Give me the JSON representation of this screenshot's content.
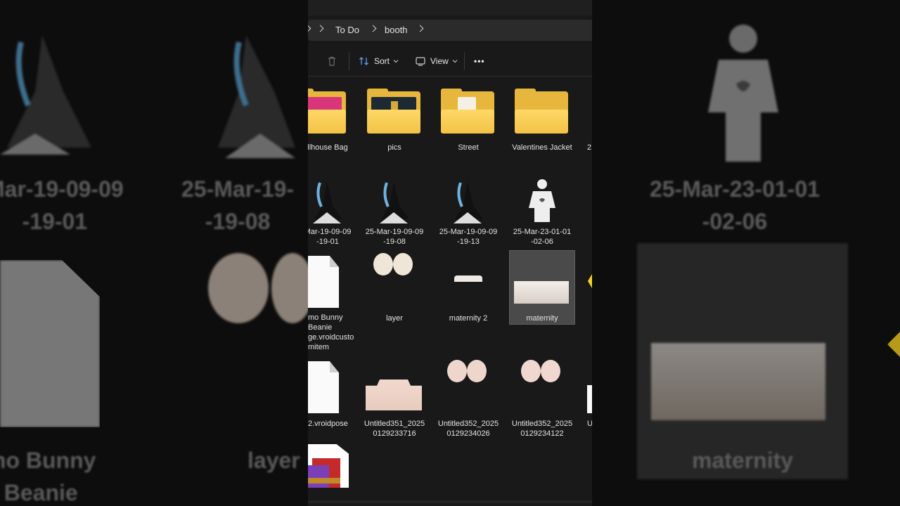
{
  "background_left": {
    "text_1": "Mar-19-09-09\n-19-01",
    "text_2": "25-Mar-19-\n-19-08",
    "text_3": "mo Bunny\nBeanie",
    "text_4": "layer"
  },
  "background_right": {
    "text_1": "25-Mar-23-01-01\n-02-06",
    "text_2": "maternity"
  },
  "explorer": {
    "breadcrumb": [
      "To Do",
      "booth"
    ],
    "toolbar": {
      "sort_label": "Sort",
      "view_label": "View",
      "more_label": "•••"
    },
    "items": [
      {
        "label": "llhouse Bag",
        "type": "folder"
      },
      {
        "label": "pics",
        "type": "folder"
      },
      {
        "label": "Street",
        "type": "folder"
      },
      {
        "label": "Valentines Jacket",
        "type": "folder"
      },
      {
        "label": "2",
        "type": "folder"
      },
      {
        "label": "Mar-19-09-09\n-19-01",
        "type": "image"
      },
      {
        "label": "25-Mar-19-09-09\n-19-08",
        "type": "image"
      },
      {
        "label": "25-Mar-19-09-09\n-19-13",
        "type": "image"
      },
      {
        "label": "25-Mar-23-01-01\n-02-06",
        "type": "image"
      },
      {
        "label": "mo Bunny\nBeanie\nge.vroidcusto\nmitem",
        "type": "file"
      },
      {
        "label": "layer",
        "type": "image"
      },
      {
        "label": "maternity 2",
        "type": "image"
      },
      {
        "label": "maternity",
        "type": "image",
        "selected": true
      },
      {
        "label": "2.vroidpose",
        "type": "file"
      },
      {
        "label": "Untitled351_2025\n0129233716",
        "type": "image"
      },
      {
        "label": "Untitled352_2025\n0129234026",
        "type": "image"
      },
      {
        "label": "Untitled352_2025\n0129234122",
        "type": "image"
      },
      {
        "label": "U",
        "type": "image"
      }
    ]
  },
  "colors": {
    "folder": "#f2c246",
    "window_bg": "#191919",
    "selection": "#4a4a4a"
  }
}
